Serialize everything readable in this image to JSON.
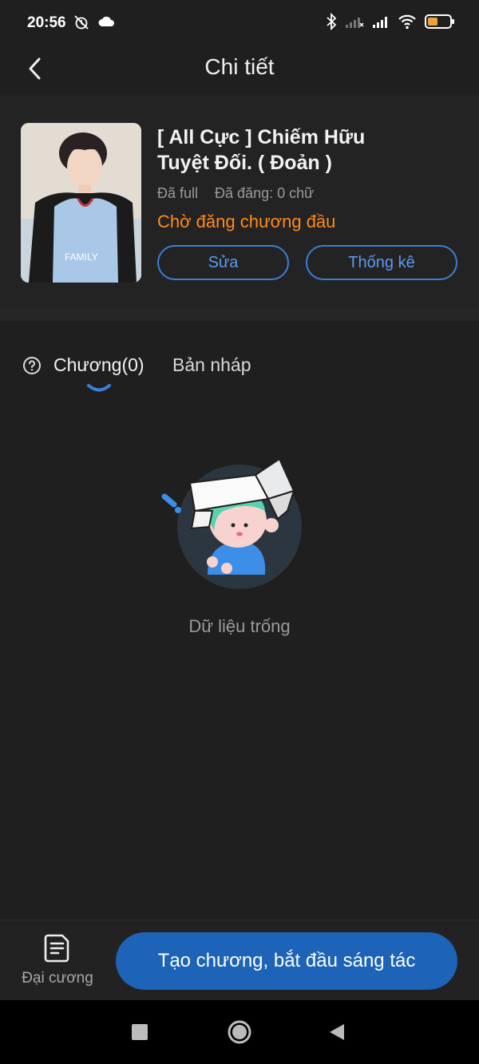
{
  "status_bar": {
    "time": "20:56",
    "icons": [
      "alarm-off-icon",
      "cloud-icon",
      "bluetooth-icon",
      "signal-off-icon",
      "signal-icon",
      "wifi-icon",
      "battery-icon"
    ],
    "battery_color": "#f0a23a"
  },
  "header": {
    "title": "Chi tiết",
    "back_icon": "chevron-left-icon"
  },
  "book": {
    "title": "[ All Cực ] Chiếm Hữu Tuyệt Đối. ( Đoản )",
    "completion": "Đã full",
    "word_count": "Đã đăng: 0 chữ",
    "status": "Chờ đăng chương đầu",
    "edit_label": "Sửa",
    "stats_label": "Thống kê"
  },
  "tabs": {
    "help_icon": "question-circle-icon",
    "chapters_label": "Chương(0)",
    "drafts_label": "Bản nháp",
    "active": "chapters"
  },
  "empty_state": {
    "text": "Dữ liệu trống"
  },
  "bottom": {
    "outline_label": "Đại cương",
    "outline_icon": "document-icon",
    "create_label": "Tạo chương, bắt đầu sáng tác"
  },
  "colors": {
    "accent": "#3b7fd6",
    "status_orange": "#ff8a1e",
    "primary_button": "#1d63b8",
    "background": "#1f1f1f"
  }
}
